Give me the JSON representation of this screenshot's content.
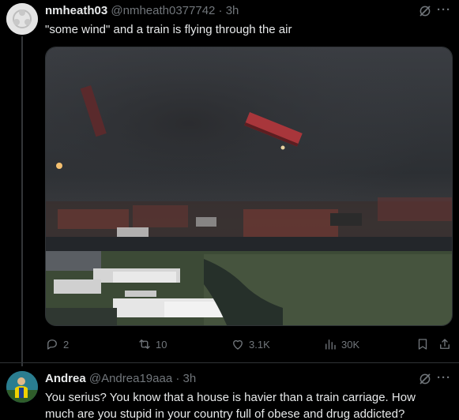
{
  "post": {
    "author_name": "nmheath03",
    "author_handle": "@nmheath0377742",
    "separator": "·",
    "time": "3h",
    "text": "\"some wind\" and a train is flying through the air",
    "media_icon": "tornado-photo",
    "actions": {
      "replies": "2",
      "reposts": "10",
      "likes": "3.1K",
      "views": "30K"
    },
    "icons": [
      "grok-icon",
      "more-icon",
      "reply-icon",
      "repost-icon",
      "like-icon",
      "views-icon",
      "bookmark-icon",
      "share-icon"
    ]
  },
  "reply": {
    "author_name": "Andrea",
    "author_handle": "@Andrea19aaa",
    "separator": "·",
    "time": "3h",
    "text": "You serius? You know that a house is havier than a train carriage. How much are you stupid in your country full of obese and drug addicted?"
  }
}
